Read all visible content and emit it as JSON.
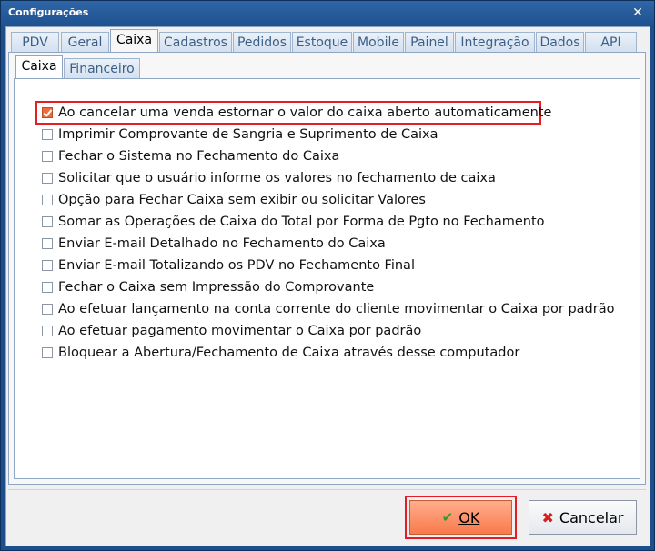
{
  "window": {
    "title": "Configurações",
    "close_glyph": "✕"
  },
  "tabs": [
    {
      "label": "PDV"
    },
    {
      "label": "Geral"
    },
    {
      "label": "Caixa"
    },
    {
      "label": "Cadastros"
    },
    {
      "label": "Pedidos"
    },
    {
      "label": "Estoque"
    },
    {
      "label": "Mobile"
    },
    {
      "label": "Painel"
    },
    {
      "label": "Integração"
    },
    {
      "label": "Dados"
    },
    {
      "label": "API"
    }
  ],
  "active_tab": "Caixa",
  "sub_tabs": [
    {
      "label": "Caixa"
    },
    {
      "label": "Financeiro"
    }
  ],
  "active_sub_tab": "Caixa",
  "options": [
    {
      "label": "Ao cancelar uma venda estornar o valor do caixa aberto automaticamente",
      "checked": true
    },
    {
      "label": "Imprimir Comprovante de Sangria e Suprimento de Caixa",
      "checked": false
    },
    {
      "label": "Fechar o Sistema no Fechamento do Caixa",
      "checked": false
    },
    {
      "label": "Solicitar que o usuário informe os valores no fechamento de caixa",
      "checked": false
    },
    {
      "label": "Opção para Fechar Caixa sem exibir ou solicitar Valores",
      "checked": false
    },
    {
      "label": "Somar as Operações de Caixa do Total por Forma de Pgto no Fechamento",
      "checked": false
    },
    {
      "label": "Enviar E-mail Detalhado no Fechamento do Caixa",
      "checked": false
    },
    {
      "label": "Enviar E-mail Totalizando os PDV no Fechamento Final",
      "checked": false
    },
    {
      "label": "Fechar o Caixa sem Impressão do Comprovante",
      "checked": false
    },
    {
      "label": "Ao efetuar lançamento na conta corrente do cliente movimentar o Caixa por padrão",
      "checked": false
    },
    {
      "label": "Ao efetuar pagamento movimentar o Caixa por padrão",
      "checked": false
    },
    {
      "label": "Bloquear a Abertura/Fechamento de Caixa através desse computador",
      "checked": false
    }
  ],
  "buttons": {
    "ok": {
      "label": "OK",
      "icon": "check-icon"
    },
    "cancel": {
      "label": "Cancelar",
      "icon": "x-icon"
    }
  },
  "colors": {
    "accent": "#f97a4c",
    "highlight_border": "#e31d23",
    "titlebar": "#1d4f8c"
  }
}
